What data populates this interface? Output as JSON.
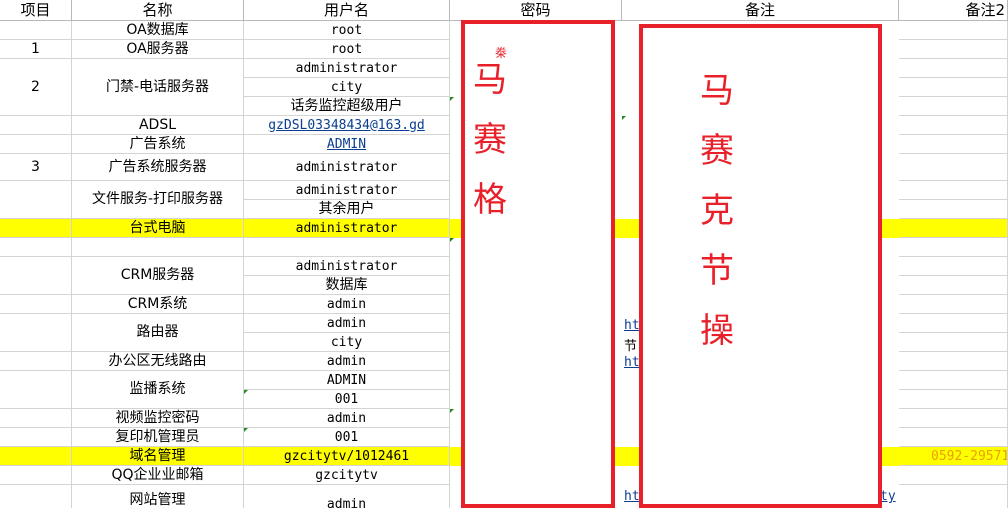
{
  "headers": {
    "item": "项目",
    "name": "名称",
    "user": "用户名",
    "pwd": "密码",
    "note": "备注",
    "note2": "备注2"
  },
  "items": [
    "1",
    "2",
    "3"
  ],
  "names": {
    "oa_db": "OA数据库",
    "oa_srv": "OA服务器",
    "door_phone": "门禁-电话服务器",
    "adsl": "ADSL",
    "ad_sys": "广告系统",
    "ad_srv": "广告系统服务器",
    "file_print": "文件服务-打印服务器",
    "desktop": "台式电脑",
    "crm_srv": "CRM服务器",
    "crm_sys": "CRM系统",
    "router": "路由器",
    "wifi": "办公区无线路由",
    "monitor": "监播系统",
    "video": "视频监控密码",
    "copier": "复印机管理员",
    "domain": "域名管理",
    "qq_mail": "QQ企业业邮箱",
    "site": "网站管理"
  },
  "users": {
    "u1": "root",
    "u2": "root",
    "u3": "administrator",
    "u4": "city",
    "u5": "话务监控超级用户",
    "u6": "gzDSL03348434@163.gd",
    "u7": "ADMIN",
    "u8": "administrator",
    "u9": "administrator",
    "u10": "其余用户",
    "u11": "administrator",
    "u12": "administrator",
    "u13": "数据库",
    "u14": "admin",
    "u15": "admin",
    "u16": "city",
    "u17": "admin",
    "u18": "ADMIN",
    "u19": "001",
    "u20": "admin",
    "u21": "001",
    "u22": "gzcitytv/1012461",
    "u23": "gzcitytv",
    "u24": "admin"
  },
  "fragments": {
    "pwd_top": "桊",
    "note_a": "ht",
    "note_b": "节",
    "note_c": "ht",
    "note_d": "ht",
    "note_e": "ty",
    "note2_domain": "0592-29571"
  },
  "redaction": {
    "pwd_text": [
      "马",
      "赛",
      "格"
    ],
    "note_text": [
      "马",
      "赛",
      "克",
      "节",
      "操"
    ]
  }
}
